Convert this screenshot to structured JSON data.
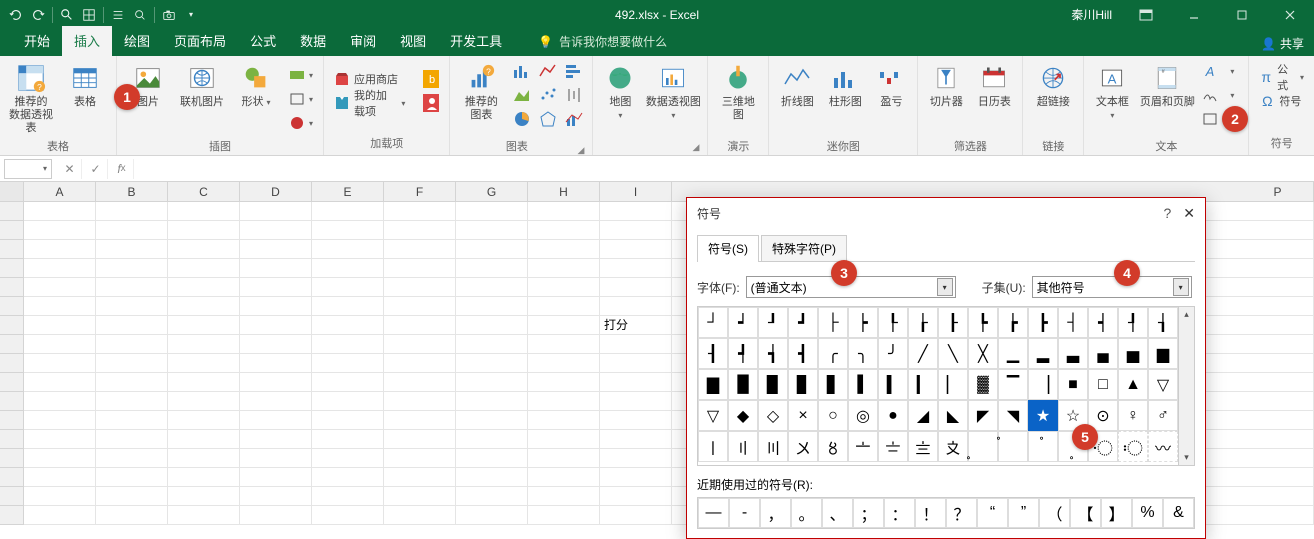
{
  "title": "492.xlsx - Excel",
  "user": "秦川Hill",
  "tabs": [
    "开始",
    "插入",
    "绘图",
    "页面布局",
    "公式",
    "数据",
    "审阅",
    "视图",
    "开发工具"
  ],
  "active_tab_index": 1,
  "tellme": "告诉我你想要做什么",
  "share": "共享",
  "ribbon": {
    "tables": {
      "pivot": "推荐的\n数据透视表",
      "table": "表格",
      "label": "表格"
    },
    "illus": {
      "pic": "图片",
      "online": "联机图片",
      "shapes": "形状",
      "label": "插图"
    },
    "addins": {
      "store": "应用商店",
      "myaddins": "我的加载项",
      "label": "加载项"
    },
    "charts": {
      "rec": "推荐的\n图表",
      "label": "图表"
    },
    "map": {
      "map": "地图",
      "pivotchart": "数据透视图"
    },
    "3d": {
      "btn": "三维地\n图",
      "label": "演示"
    },
    "spark": {
      "line": "折线图",
      "col": "柱形图",
      "wl": "盈亏",
      "label": "迷你图"
    },
    "filter": {
      "slicer": "切片器",
      "timeline": "日历表",
      "label": "筛选器"
    },
    "link": {
      "hyper": "超链接",
      "label": "链接"
    },
    "text": {
      "textbox": "文本框",
      "hf": "页眉和页脚",
      "label": "文本"
    },
    "symbols": {
      "eq": "公式",
      "sym": "符号",
      "label": "符号"
    }
  },
  "columns": [
    "A",
    "B",
    "C",
    "D",
    "E",
    "F",
    "G",
    "H",
    "I",
    "",
    "",
    "",
    "",
    "",
    "",
    "P"
  ],
  "cell_I7": "打分",
  "dialog": {
    "title": "符号",
    "tab1": "符号(S)",
    "tab2": "特殊字符(P)",
    "font_label": "字体(F):",
    "font_value": "(普通文本)",
    "subset_label": "子集(U):",
    "subset_value": "其他符号",
    "recent_label": "近期使用过的符号(R):",
    "symbols_row1": [
      "┘",
      "┙",
      "┚",
      "┛",
      "├",
      "┝",
      "┞",
      "┟",
      "┠",
      "┡",
      "┢",
      "┣",
      "┤",
      "┥",
      "┦",
      "┧"
    ],
    "symbols_row2": [
      "┨",
      "┩",
      "┪",
      "┫",
      "╭",
      "╮",
      "╯",
      "╱",
      "╲",
      "╳",
      "▁",
      "▂",
      "▃",
      "▄",
      "▅",
      "▆"
    ],
    "symbols_row3": [
      "▇",
      "█",
      "▉",
      "▊",
      "▋",
      "▌",
      "▍",
      "▎",
      "▏",
      "▓",
      "▔",
      "▕",
      "■",
      "□",
      "▲",
      "▽"
    ],
    "symbols_row4": [
      "▽",
      "◆",
      "◇",
      "×",
      "○",
      "◎",
      "●",
      "◢",
      "◣",
      "◤",
      "◥",
      "★",
      "☆",
      "⊙",
      "♀",
      "♂"
    ],
    "symbols_row5": [
      "〡",
      "〢",
      "〣",
      "〤",
      "〥",
      "〦",
      "〧",
      "〨",
      "〩",
      "〪",
      "〫",
      "〬",
      "〭",
      "〮",
      "〯",
      "〰"
    ],
    "recent": [
      "—",
      "-",
      "，",
      "。",
      "、",
      "；",
      "：",
      "！",
      "？",
      "“",
      "”",
      "（",
      "【",
      "】",
      "%",
      "&"
    ],
    "selected_index": 59
  },
  "callouts": {
    "1": "1",
    "2": "2",
    "3": "3",
    "4": "4",
    "5": "5"
  }
}
